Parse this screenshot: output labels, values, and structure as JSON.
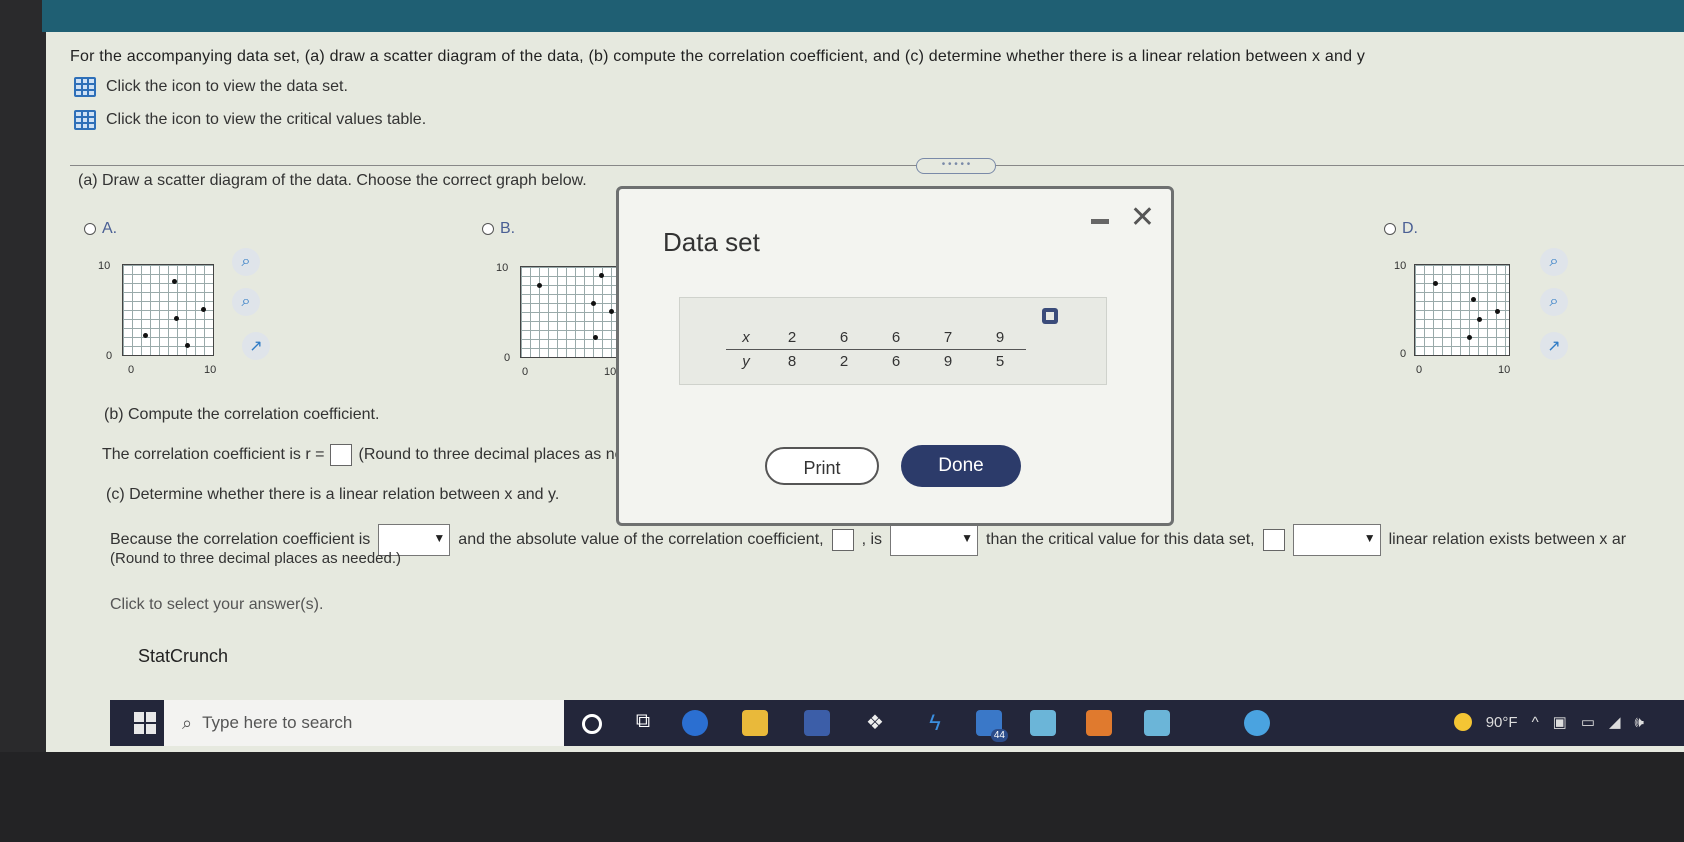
{
  "problem": {
    "statement": "For the accompanying data set, (a) draw a scatter diagram of the data, (b) compute the correlation coefficient, and (c) determine whether there is a linear relation between x and y",
    "link_data_set": "Click the icon to view the data set.",
    "link_critical": "Click the icon to view the critical values table."
  },
  "part_a": {
    "prompt": "(a) Draw a scatter diagram of the data. Choose the correct graph below.",
    "choices": [
      {
        "label": "A.",
        "ymax": "10",
        "xmin": "0",
        "xmax": "10",
        "ymin": "0"
      },
      {
        "label": "B.",
        "ymax": "10",
        "xmin": "0",
        "xmax": "10",
        "ymin": "0"
      },
      {
        "label": "D.",
        "ymax": "10",
        "xmin": "0",
        "xmax": "10",
        "ymin": "0"
      }
    ]
  },
  "part_b": {
    "prompt": "(b) Compute the correlation coefficient.",
    "line_pre": "The correlation coefficient is r =",
    "line_post": "(Round to three decimal places as nee"
  },
  "part_c": {
    "prompt": "(c) Determine whether there is a linear relation between x and y.",
    "seg1": "Because the correlation coefficient is",
    "seg2": "and the absolute value of the correlation coefficient,",
    "seg3": ", is",
    "seg4": "than the critical value for this data set,",
    "seg5": "linear relation exists between x ar",
    "round_note": "(Round to three decimal places as needed.)"
  },
  "footer": {
    "select_hint": "Click to select your answer(s).",
    "statcrunch": "StatCrunch"
  },
  "modal": {
    "title": "Data set",
    "x_label": "x",
    "y_label": "y",
    "x_values": [
      "2",
      "6",
      "6",
      "7",
      "9"
    ],
    "y_values": [
      "8",
      "2",
      "6",
      "9",
      "5"
    ],
    "print_label": "Print",
    "done_label": "Done"
  },
  "taskbar": {
    "search_placeholder": "Type here to search",
    "temperature": "90°F",
    "badge_count": "44"
  }
}
